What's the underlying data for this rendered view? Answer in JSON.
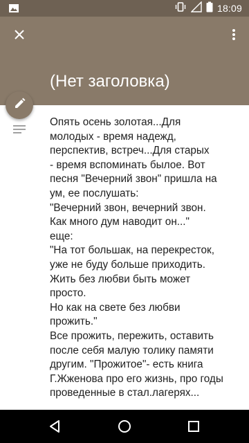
{
  "status_bar": {
    "time": "18:09",
    "icons": [
      "image-notification-icon",
      "vibrate-icon",
      "signal-icon",
      "battery-icon"
    ]
  },
  "header": {
    "title": "(Нет заголовка)",
    "close_icon": "close-icon",
    "menu_icon": "more-vert-icon",
    "color": "#897a69"
  },
  "fab": {
    "icon": "pencil-icon"
  },
  "note": {
    "lines": [
      "Опять осень золотая...Для",
      "молодых - время надежд,",
      "перспектив, встреч...Для старых",
      "- время вспоминать былое. Вот",
      "песня \"Вечерний звон\" пришла на",
      "ум, ее послушать:",
      "\"Вечерний звон, вечерний звон.",
      "Как много дум наводит он...\"",
      "еще:",
      "\"На тот большак, на перекресток,",
      "уже не буду больше приходить.",
      "Жить без любви быть может",
      "просто.",
      "Но как на свете без любви",
      "прожить.\"",
      "Все прожить, пережить, оставить",
      "после себя малую толику памяти",
      "другим. \"Прожитое\"- есть книга",
      "Г.Жженова про его жизнь, про годы",
      "проведенные в стал.лагерях..."
    ]
  },
  "nav_bar": {
    "icons": [
      "back-icon",
      "home-icon",
      "recents-icon"
    ]
  }
}
